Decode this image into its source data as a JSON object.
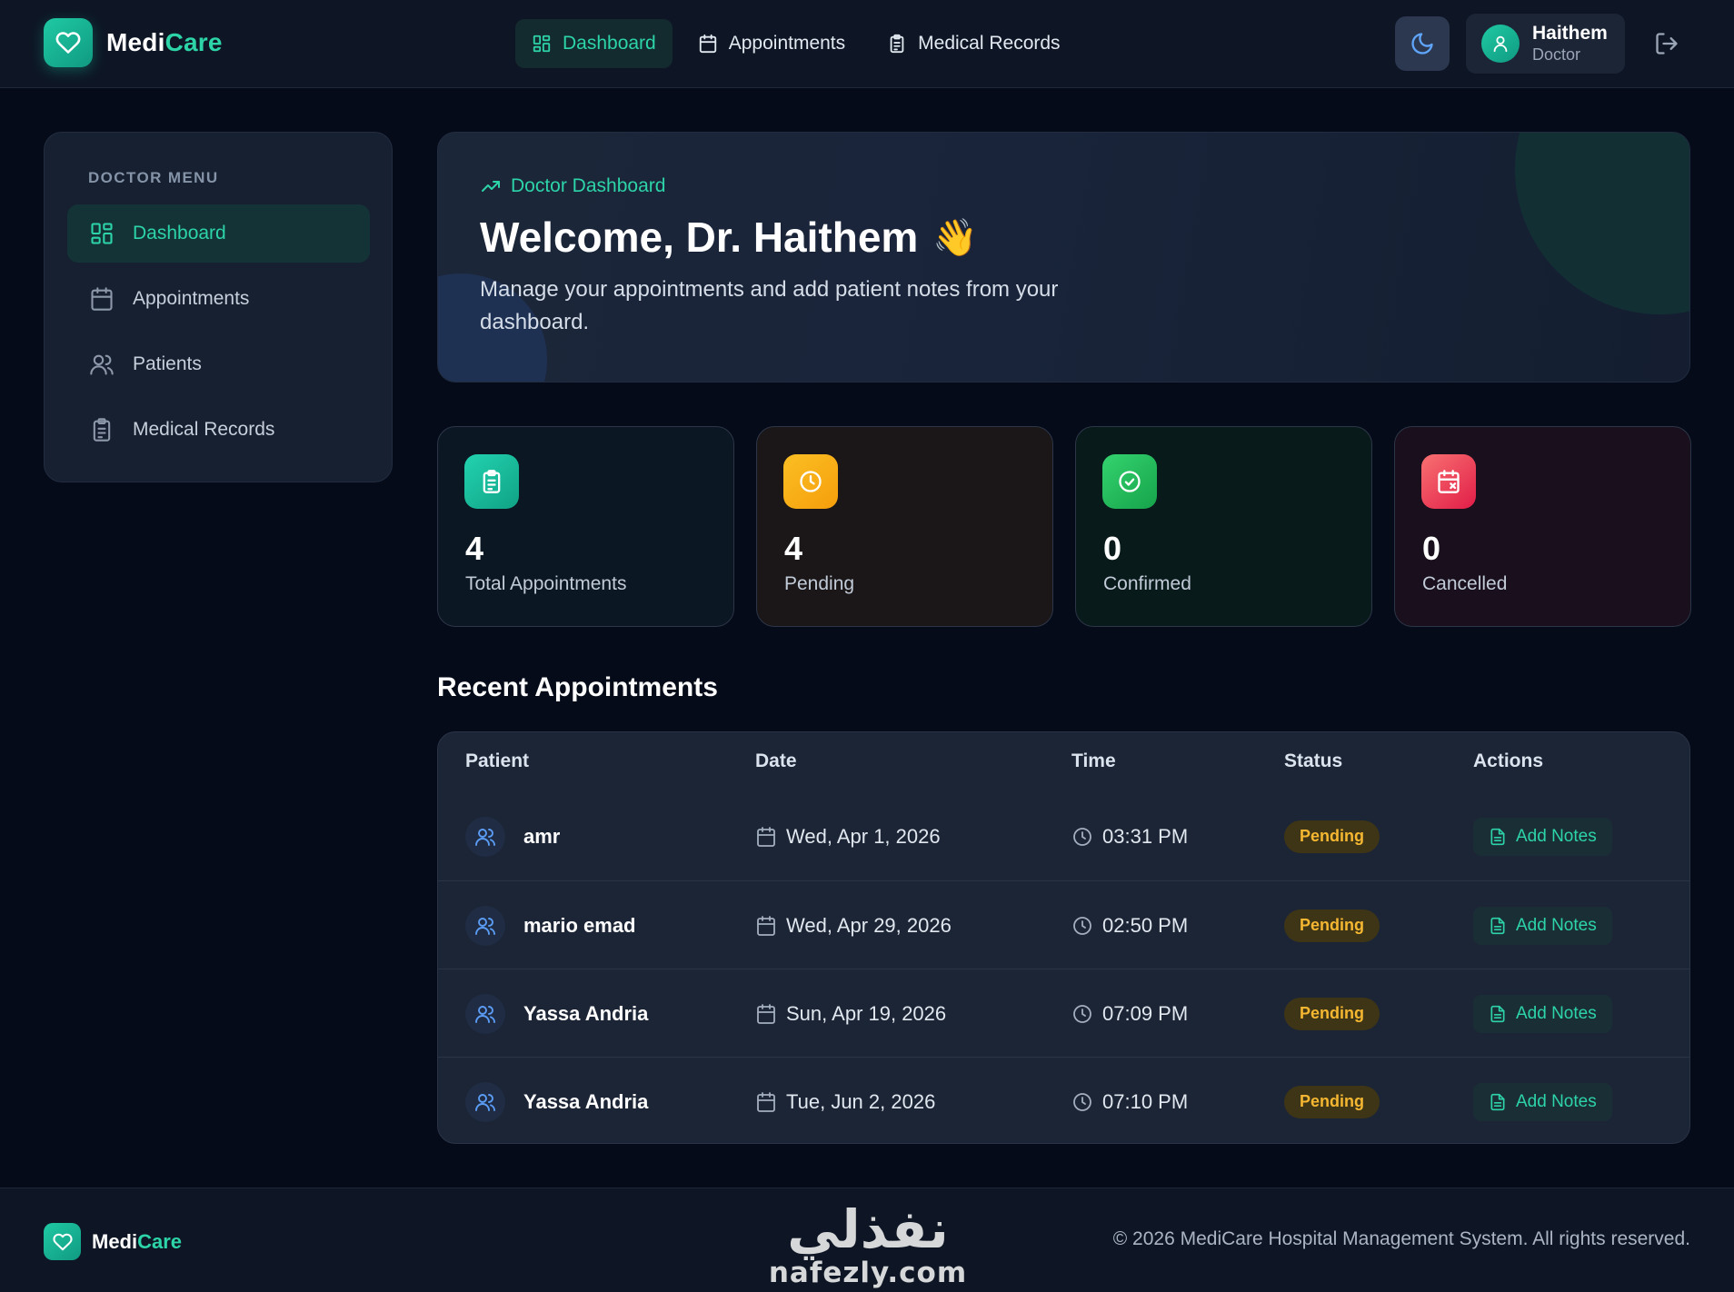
{
  "brand": {
    "name_main": "Medi",
    "name_accent": "Care"
  },
  "nav": {
    "items": [
      {
        "label": "Dashboard",
        "icon": "layout-grid-icon",
        "active": true
      },
      {
        "label": "Appointments",
        "icon": "calendar-icon",
        "active": false
      },
      {
        "label": "Medical Records",
        "icon": "clipboard-icon",
        "active": false
      }
    ]
  },
  "header": {
    "theme_icon": "moon-icon",
    "user": {
      "name": "Haithem",
      "role": "Doctor"
    },
    "logout_icon": "logout-icon"
  },
  "sidebar": {
    "title": "DOCTOR MENU",
    "items": [
      {
        "label": "Dashboard",
        "icon": "layout-grid-icon",
        "active": true
      },
      {
        "label": "Appointments",
        "icon": "calendar-icon",
        "active": false
      },
      {
        "label": "Patients",
        "icon": "users-icon",
        "active": false
      },
      {
        "label": "Medical Records",
        "icon": "clipboard-icon",
        "active": false
      }
    ]
  },
  "hero": {
    "eyebrow": "Doctor Dashboard",
    "title": "Welcome, Dr. Haithem",
    "emoji": "👋",
    "subtitle": "Manage your appointments and add patient notes from your dashboard."
  },
  "stats": [
    {
      "value": "4",
      "label": "Total Appointments",
      "icon": "clipboard-icon",
      "color": "#1fc9a3"
    },
    {
      "value": "4",
      "label": "Pending",
      "icon": "clock-icon",
      "color": "#f6a416"
    },
    {
      "value": "0",
      "label": "Confirmed",
      "icon": "check-circle-icon",
      "color": "#22c55e"
    },
    {
      "value": "0",
      "label": "Cancelled",
      "icon": "calendar-x-icon",
      "color": "#f04d5c"
    }
  ],
  "recent": {
    "title": "Recent Appointments",
    "columns": [
      "Patient",
      "Date",
      "Time",
      "Status",
      "Actions"
    ],
    "rows": [
      {
        "patient": "amr",
        "date": "Wed, Apr 1, 2026",
        "time": "03:31 PM",
        "status": "Pending",
        "action": "Add Notes"
      },
      {
        "patient": "mario emad",
        "date": "Wed, Apr 29, 2026",
        "time": "02:50 PM",
        "status": "Pending",
        "action": "Add Notes"
      },
      {
        "patient": "Yassa Andria",
        "date": "Sun, Apr 19, 2026",
        "time": "07:09 PM",
        "status": "Pending",
        "action": "Add Notes"
      },
      {
        "patient": "Yassa Andria",
        "date": "Tue, Jun 2, 2026",
        "time": "07:10 PM",
        "status": "Pending",
        "action": "Add Notes"
      }
    ]
  },
  "footer": {
    "brand_main": "Medi",
    "brand_accent": "Care",
    "copyright": "© 2026 MediCare Hospital Management System. All rights reserved.",
    "watermark_ar": "نفذلي",
    "watermark_en": "nafezly.com"
  },
  "colors": {
    "accent": "#2dd4a8",
    "background": "#050b18",
    "card": "#1c2536",
    "pending": "#f5b731"
  }
}
